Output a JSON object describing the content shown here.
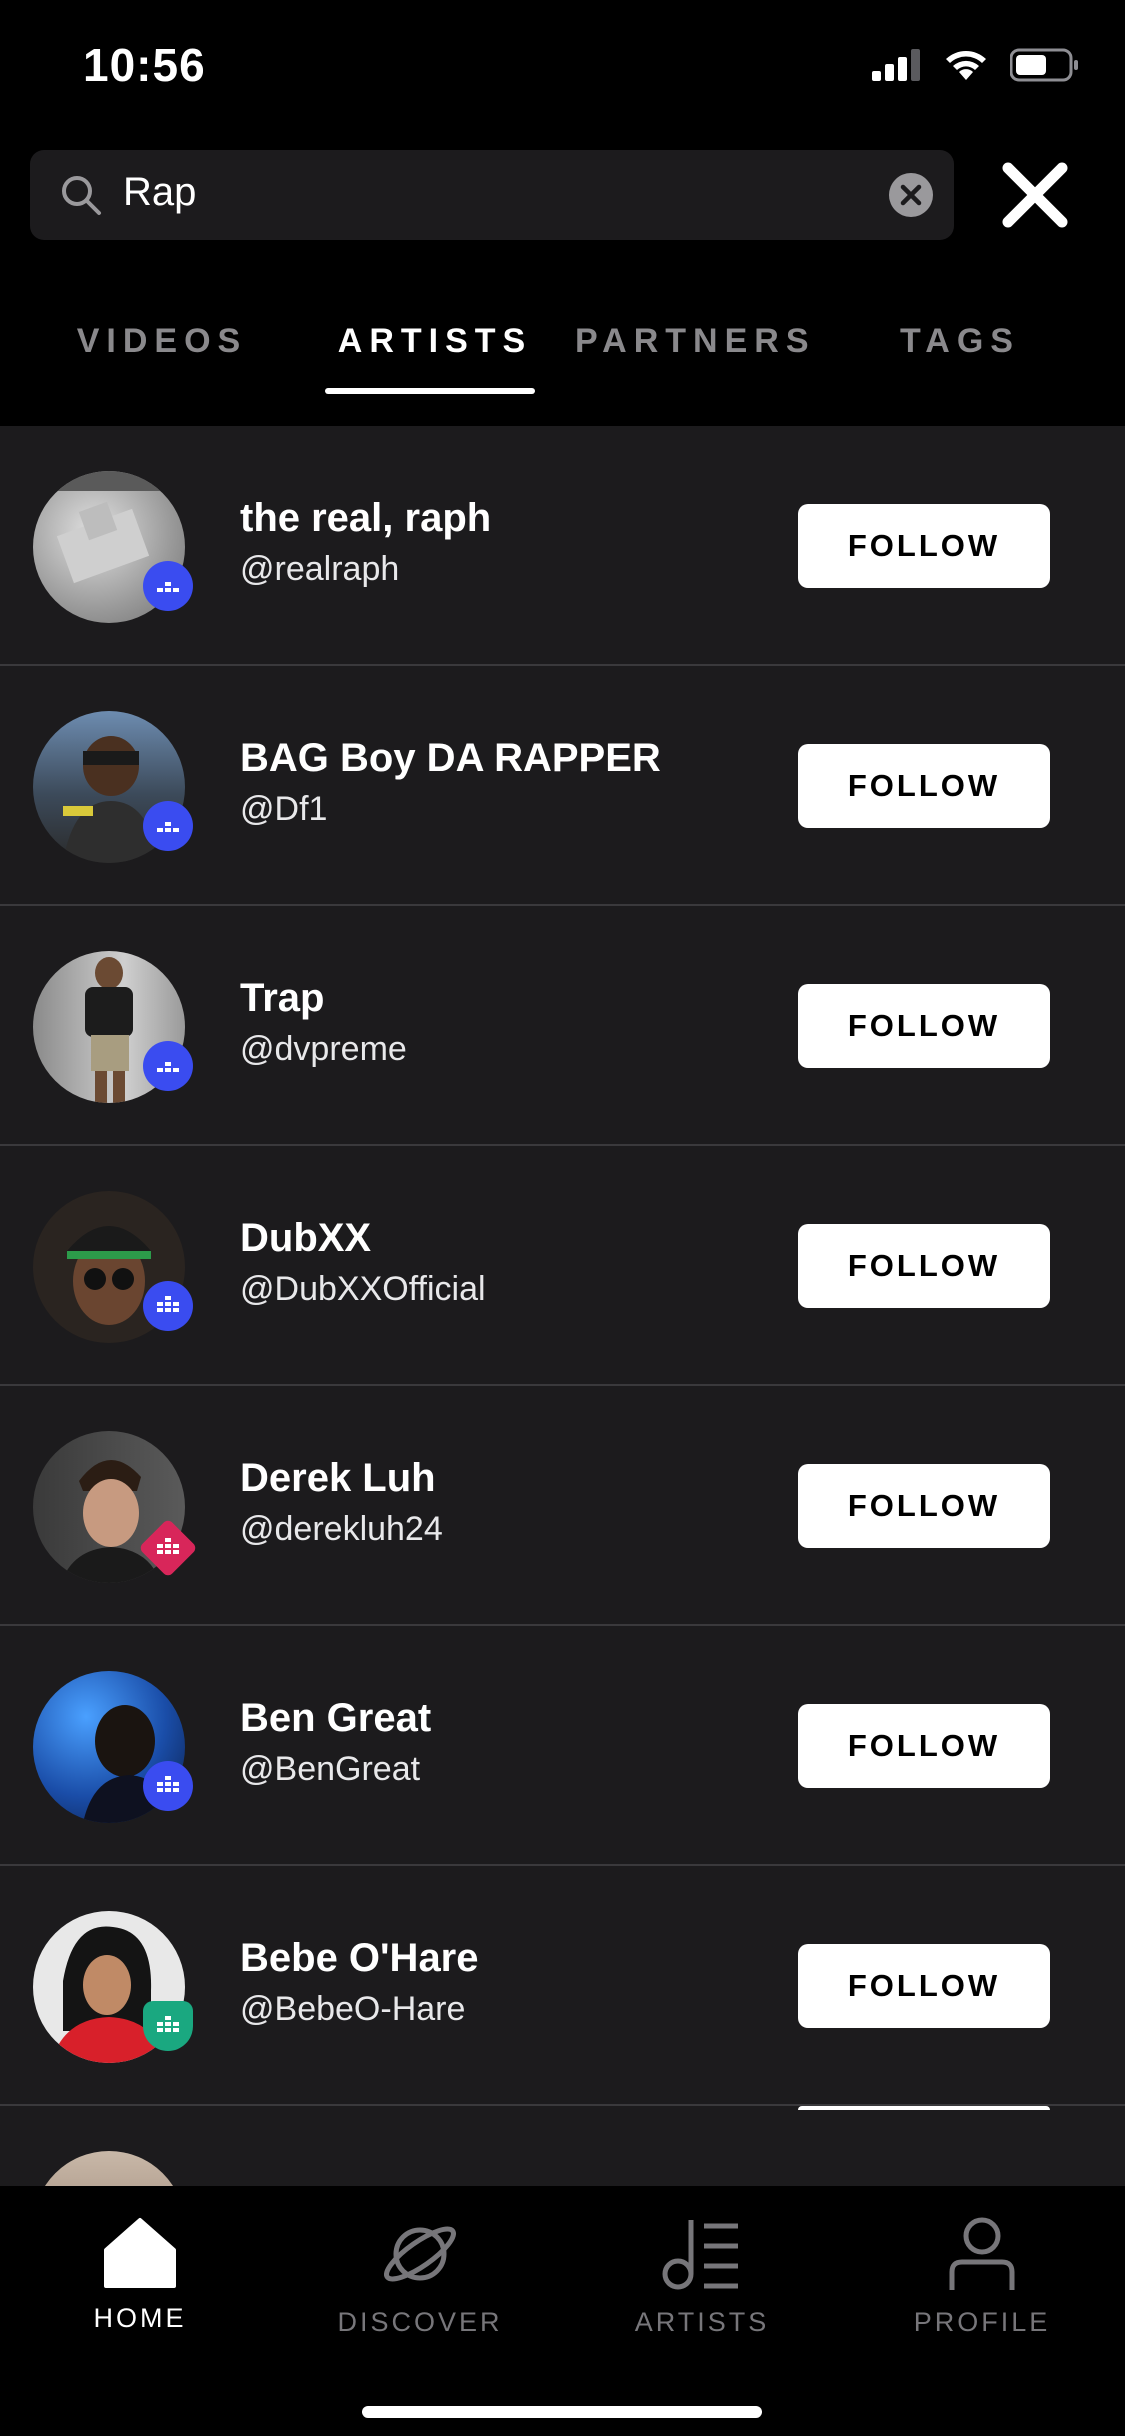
{
  "status_bar": {
    "time": "10:56"
  },
  "search": {
    "query": "Rap"
  },
  "tabs": [
    {
      "label": "VIDEOS"
    },
    {
      "label": "ARTISTS"
    },
    {
      "label": "PARTNERS"
    },
    {
      "label": "TAGS"
    }
  ],
  "active_tab": "ARTISTS",
  "artists": [
    {
      "name": "the real, raph",
      "handle": "@realraph",
      "follow_label": "FOLLOW",
      "badge": "blue"
    },
    {
      "name": "BAG Boy DA RAPPER",
      "handle": "@Df1",
      "follow_label": "FOLLOW",
      "badge": "blue"
    },
    {
      "name": "Trap",
      "handle": "@dvpreme",
      "follow_label": "FOLLOW",
      "badge": "blue"
    },
    {
      "name": "DubXX",
      "handle": "@DubXXOfficial",
      "follow_label": "FOLLOW",
      "badge": "blue"
    },
    {
      "name": "Derek Luh",
      "handle": "@derekluh24",
      "follow_label": "FOLLOW",
      "badge": "red"
    },
    {
      "name": "Ben Great",
      "handle": "@BenGreat",
      "follow_label": "FOLLOW",
      "badge": "blue"
    },
    {
      "name": "Bebe O'Hare",
      "handle": "@BebeO-Hare",
      "follow_label": "FOLLOW",
      "badge": "green"
    }
  ],
  "bottom_nav": [
    {
      "label": "HOME",
      "icon": "home-icon"
    },
    {
      "label": "DISCOVER",
      "icon": "planet-icon"
    },
    {
      "label": "ARTISTS",
      "icon": "music-list-icon"
    },
    {
      "label": "PROFILE",
      "icon": "person-icon"
    }
  ],
  "colors": {
    "badge_blue": "#3a4cf0",
    "badge_red": "#d8265a",
    "badge_green": "#1aa880",
    "list_bg": "#1c1b1d"
  }
}
